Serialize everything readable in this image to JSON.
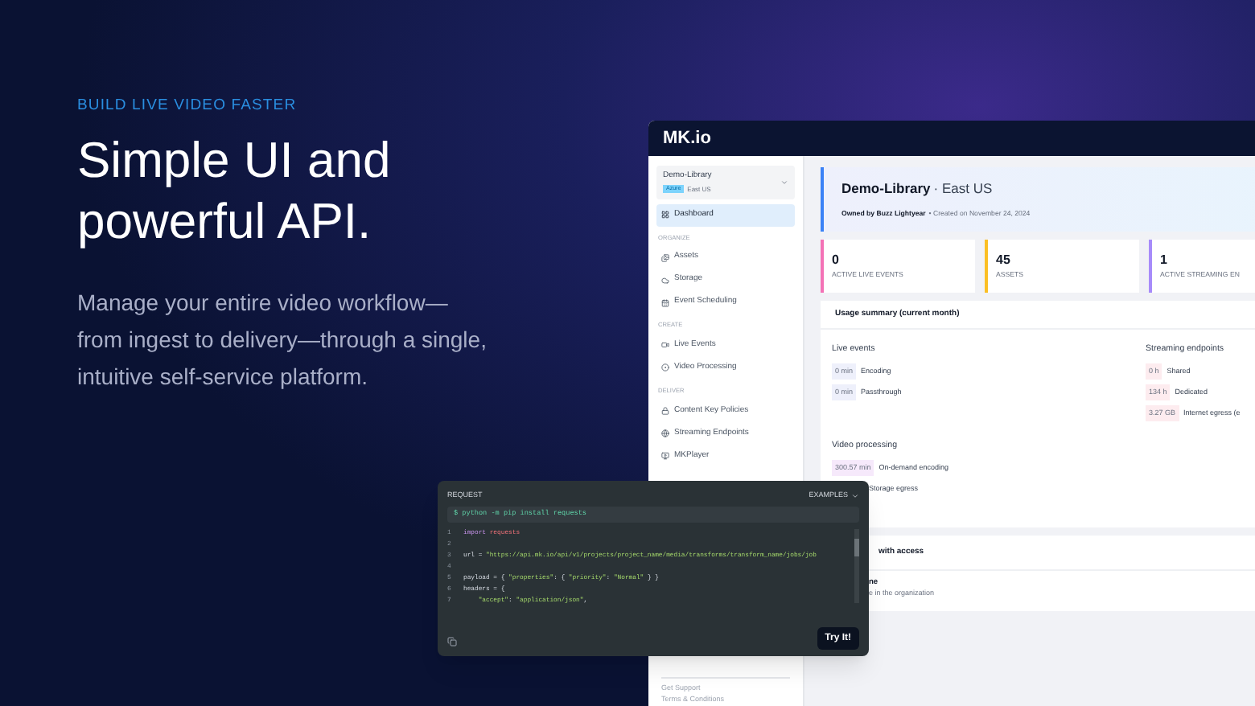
{
  "hero": {
    "eyebrow": "BUILD LIVE VIDEO FASTER",
    "headline": "Simple UI and powerful API.",
    "description": "Manage your entire video workflow—from ingest to delivery—through a single, intuitive  self-service platform."
  },
  "app": {
    "logo": "MK.io",
    "project": {
      "name": "Demo-Library",
      "badge": "Azure",
      "region": "East US"
    },
    "sidebar": [
      {
        "kind": "item",
        "label": "Dashboard",
        "selected": true
      },
      {
        "kind": "section",
        "label": "ORGANIZE"
      },
      {
        "kind": "item",
        "label": "Assets",
        "selected": false
      },
      {
        "kind": "item",
        "label": "Storage",
        "selected": false
      },
      {
        "kind": "item",
        "label": "Event Scheduling",
        "selected": false
      },
      {
        "kind": "section",
        "label": "CREATE"
      },
      {
        "kind": "item",
        "label": "Live Events",
        "selected": false
      },
      {
        "kind": "item",
        "label": "Video Processing",
        "selected": false
      },
      {
        "kind": "section",
        "label": "DELIVER"
      },
      {
        "kind": "item",
        "label": "Content Key Policies",
        "selected": false
      },
      {
        "kind": "item",
        "label": "Streaming Endpoints",
        "selected": false
      },
      {
        "kind": "item",
        "label": "MKPlayer",
        "selected": false
      }
    ],
    "sidebar_footer": [
      "Get Support",
      "Terms & Conditions"
    ],
    "header": {
      "title": "Demo-Library",
      "region": "· East US",
      "owner": "Owned by Buzz Lightyear",
      "created": "• Created on November 24, 2024"
    },
    "stats": [
      {
        "value": "0",
        "label": "ACTIVE LIVE EVENTS",
        "color": "#f472b6"
      },
      {
        "value": "45",
        "label": "ASSETS",
        "color": "#fbbf24"
      },
      {
        "value": "1",
        "label": "ACTIVE STREAMING EN",
        "color": "#a78bfa"
      }
    ],
    "usage": {
      "title": "Usage summary (current month)",
      "groups": [
        {
          "title": "Live events",
          "color": "#eef0fb",
          "rows": [
            {
              "value": "0 min",
              "label": "Encoding"
            },
            {
              "value": "0 min",
              "label": "Passthrough"
            }
          ]
        },
        {
          "title": "Streaming endpoints",
          "color": "#fdecef",
          "rows": [
            {
              "value": "0 h",
              "label": "Shared"
            },
            {
              "value": "134 h",
              "label": "Dedicated"
            },
            {
              "value": "3.27 GB",
              "label": "Internet egress (e"
            }
          ]
        },
        {
          "title": "Video processing",
          "color": "#f6e9fb",
          "rows": [
            {
              "value": "300.57 min",
              "label": "On-demand encoding"
            },
            {
              "label": "Storage egress"
            }
          ]
        }
      ]
    },
    "access": {
      "title": "with access",
      "line_1": "ne",
      "line_2": "e in the organization"
    }
  },
  "request": {
    "title": "REQUEST",
    "examples": "EXAMPLES",
    "command": "$ python -m pip install requests",
    "lines": [
      {
        "n": "1",
        "tokens": [
          {
            "kind": "keyword",
            "text": "import"
          },
          {
            "kind": "name",
            "text": " requests"
          }
        ]
      },
      {
        "n": "2"
      },
      {
        "n": "3",
        "tokens": [
          {
            "kind": "plain",
            "text": "url = "
          },
          {
            "kind": "string",
            "text": "\"https://api.mk.io/api/v1/projects/project_name/media/transforms/transform_name/jobs/job"
          }
        ]
      },
      {
        "n": "4"
      },
      {
        "n": "5",
        "tokens": [
          {
            "kind": "plain",
            "text": "payload = { "
          },
          {
            "kind": "string",
            "text": "\"properties\""
          },
          {
            "kind": "plain",
            "text": ": { "
          },
          {
            "kind": "string",
            "text": "\"priority\""
          },
          {
            "kind": "plain",
            "text": ": "
          },
          {
            "kind": "string",
            "text": "\"Normal\""
          },
          {
            "kind": "plain",
            "text": " } }"
          }
        ]
      },
      {
        "n": "6",
        "tokens": [
          {
            "kind": "plain",
            "text": "headers = {"
          }
        ]
      },
      {
        "n": "7",
        "tokens": [
          {
            "kind": "string",
            "text": "    \"accept\""
          },
          {
            "kind": "plain",
            "text": ": "
          },
          {
            "kind": "string",
            "text": "\"application/json\""
          },
          {
            "kind": "plain",
            "text": ","
          }
        ]
      }
    ],
    "button": "Try It!"
  }
}
